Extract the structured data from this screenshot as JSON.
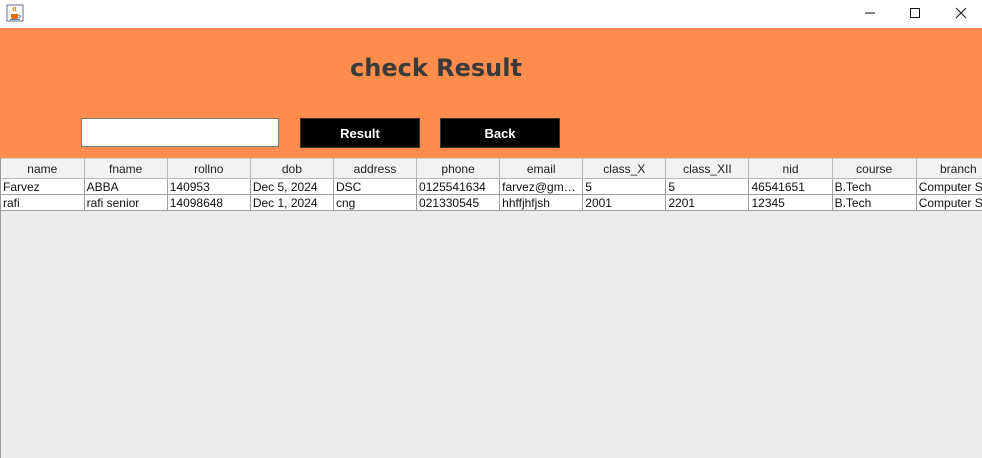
{
  "window": {
    "icon": "java-cup-icon",
    "minimize_glyph": "—",
    "maximize_glyph": "☐",
    "close_glyph": "✕"
  },
  "header": {
    "title": "check Result",
    "background_color": "#ff8c4a"
  },
  "search": {
    "value": "",
    "placeholder": ""
  },
  "buttons": {
    "result_label": "Result",
    "back_label": "Back"
  },
  "table": {
    "columns": [
      "name",
      "fname",
      "rollno",
      "dob",
      "address",
      "phone",
      "email",
      "class_X",
      "class_XII",
      "nid",
      "course",
      "branch"
    ],
    "rows": [
      [
        "Farvez",
        "ABBA",
        "140953",
        "Dec 5, 2024",
        "DSC",
        "0125541634",
        "farvez@gmai...",
        "5",
        "5",
        "46541651",
        "B.Tech",
        "Computer S"
      ],
      [
        "rafi",
        "rafi senior",
        "14098648",
        "Dec 1, 2024",
        "cng",
        "021330545",
        "hhffjhfjsh",
        "2001",
        "2201",
        "12345",
        "B.Tech",
        "Computer S"
      ]
    ]
  }
}
